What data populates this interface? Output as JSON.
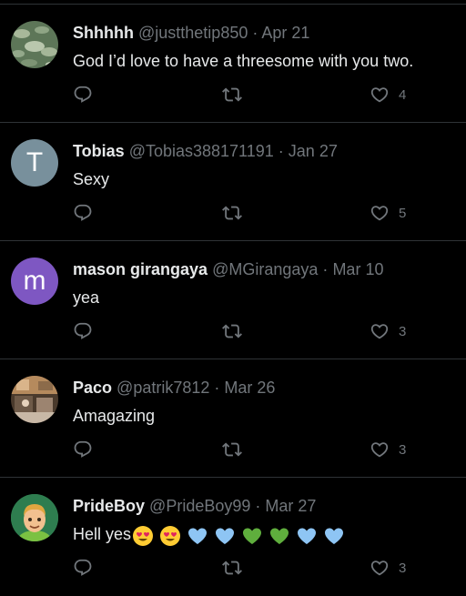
{
  "replies": [
    {
      "name": "Shhhhh",
      "handle": "@justthetip850",
      "dot": "·",
      "date": "Apr 21",
      "text": "God I’d love to have a threesome with you two.",
      "likes": "4",
      "avatar": {
        "type": "photo-lilypads",
        "color": "#6f8a6a"
      }
    },
    {
      "name": "Tobias",
      "handle": "@Tobias388171191",
      "dot": "·",
      "date": "Jan 27",
      "text": "Sexy",
      "likes": "5",
      "avatar": {
        "type": "letter",
        "letter": "T",
        "color": "#78909c"
      }
    },
    {
      "name": "mason girangaya",
      "handle": "@MGirangaya",
      "dot": "·",
      "date": "Mar 10",
      "text": "yea",
      "likes": "3",
      "avatar": {
        "type": "letter",
        "letter": "m",
        "color": "#7e57c2"
      }
    },
    {
      "name": "Paco",
      "handle": "@patrik7812",
      "dot": "·",
      "date": "Mar 26",
      "text": "Amagazing",
      "likes": "3",
      "avatar": {
        "type": "photo-room",
        "color": "#8a6a4e"
      }
    },
    {
      "name": "PrideBoy",
      "handle": "@PrideBoy99",
      "dot": "·",
      "date": "Mar 27",
      "text": "Hell yes",
      "emojis": [
        "heart-eyes-emoji",
        "heart-eyes-emoji",
        "blue-heart-emoji",
        "blue-heart-emoji",
        "green-heart-emoji",
        "green-heart-emoji",
        "blue-heart-emoji",
        "blue-heart-emoji"
      ],
      "likes": "3",
      "avatar": {
        "type": "memoji",
        "color": "#2e7d4f"
      }
    }
  ],
  "icons": {
    "reply": "reply-icon",
    "repost": "repost-icon",
    "like": "heart-icon"
  },
  "colors": {
    "background": "#000000",
    "text": "#e7e9ea",
    "secondary": "#71767b",
    "divider": "#2f3336",
    "blue_heart": "#8ec5f4",
    "green_heart": "#5fae3d"
  }
}
